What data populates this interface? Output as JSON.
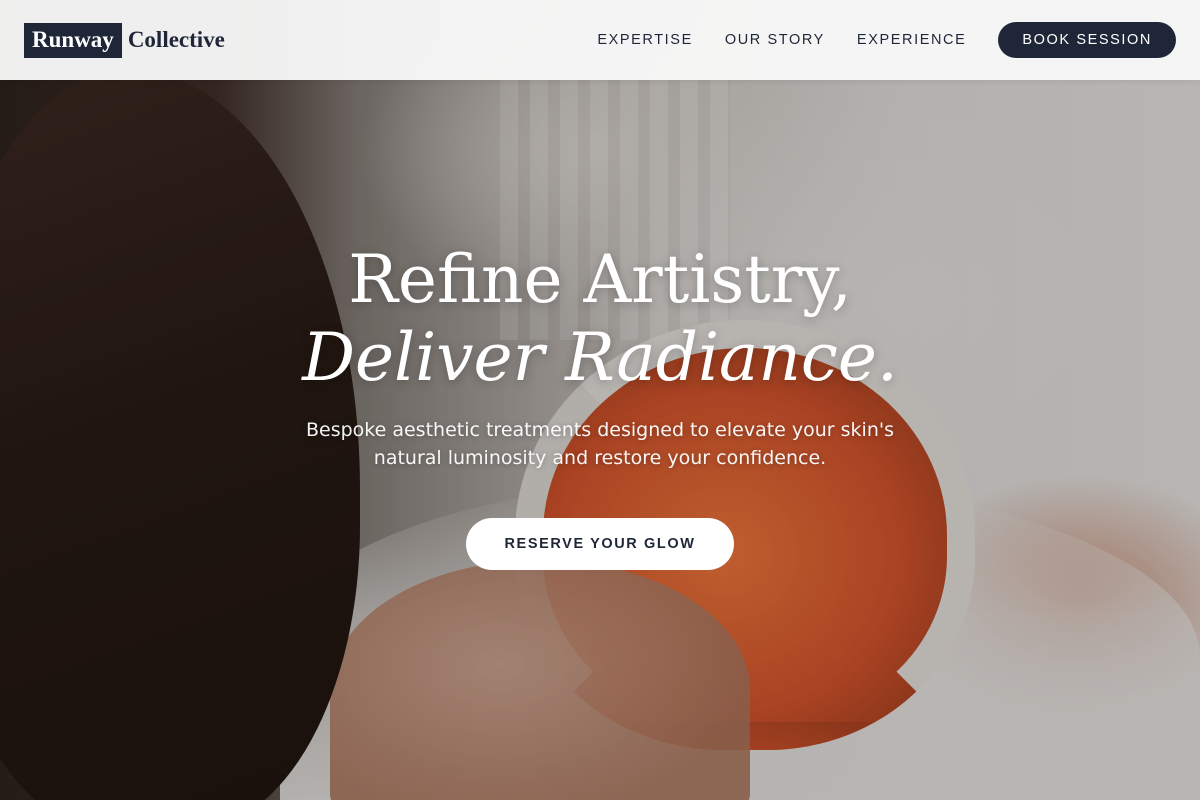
{
  "header": {
    "logo_box_text": "Runway",
    "logo_text": "Collective",
    "nav": [
      "EXPERTISE",
      "OUR STORY",
      "EXPERIENCE"
    ],
    "cta_label": "BOOK SESSION"
  },
  "hero": {
    "headline_line1": "Refine Artistry,",
    "headline_line2": "Deliver Radiance.",
    "subtitle": "Bespoke aesthetic treatments designed to elevate your skin's natural luminosity and restore your confidence.",
    "button_label": "RESERVE YOUR GLOW"
  },
  "colors": {
    "brand_navy": "#1e2638",
    "header_bg": "#f8f8f8",
    "hero_text": "#ffffff"
  }
}
